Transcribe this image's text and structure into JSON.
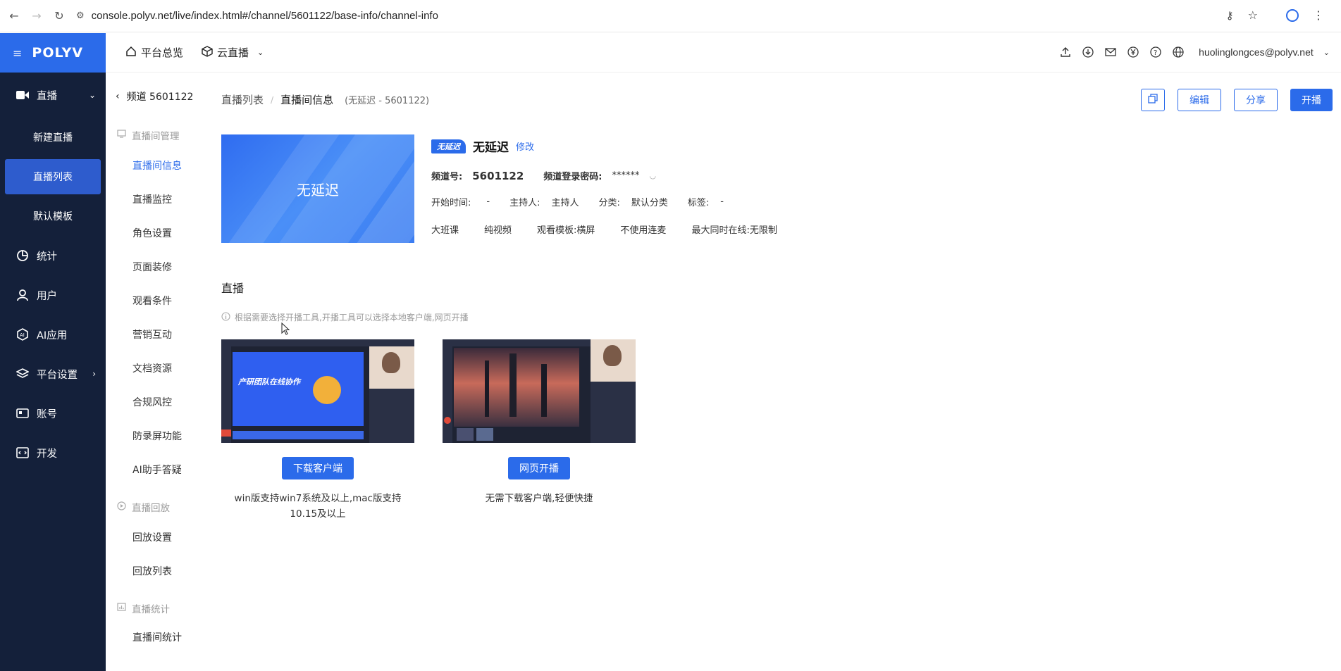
{
  "browser": {
    "url": "console.polyv.net/live/index.html#/channel/5601122/base-info/channel-info"
  },
  "sidebar": {
    "logo": "POLYV",
    "items": [
      {
        "label": "直播",
        "icon": "video-camera-icon"
      },
      {
        "label": "新建直播"
      },
      {
        "label": "直播列表"
      },
      {
        "label": "默认模板"
      },
      {
        "label": "统计",
        "icon": "pie-chart-icon"
      },
      {
        "label": "用户",
        "icon": "user-icon"
      },
      {
        "label": "AI应用",
        "icon": "ai-icon"
      },
      {
        "label": "平台设置",
        "icon": "layers-icon"
      },
      {
        "label": "账号",
        "icon": "id-card-icon"
      },
      {
        "label": "开发",
        "icon": "code-icon"
      }
    ]
  },
  "topbar": {
    "overview": "平台总览",
    "cloud_live": "云直播",
    "email": "huolinglongces@polyv.net"
  },
  "subnav": {
    "back": "频道 5601122",
    "group1": "直播间管理",
    "group1_items": [
      "直播间信息",
      "直播监控",
      "角色设置",
      "页面装修",
      "观看条件",
      "营销互动",
      "文档资源",
      "合规风控",
      "防录屏功能",
      "AI助手答疑"
    ],
    "group2": "直播回放",
    "group2_items": [
      "回放设置",
      "回放列表"
    ],
    "group3": "直播统计",
    "group3_items": [
      "直播间统计"
    ]
  },
  "main": {
    "crumb_list": "直播列表",
    "crumb_sep": "/",
    "crumb_current": "直播间信息",
    "crumb_sub": "(无延迟 - 5601122)",
    "btn_edit": "编辑",
    "btn_share": "分享",
    "btn_start": "开播",
    "cover_text": "无延迟",
    "badge": "无延迟",
    "title": "无延迟",
    "modify": "修改",
    "channel_no_label": "频道号:",
    "channel_no": "5601122",
    "pwd_label": "频道登录密码:",
    "pwd": "******",
    "start_label": "开始时间:",
    "start_val": "-",
    "host_label": "主持人:",
    "host_val": "主持人",
    "cat_label": "分类:",
    "cat_val": "默认分类",
    "tag_label": "标签:",
    "tag_val": "-",
    "tags_row": [
      "大班课",
      "纯视频",
      "观看模板:横屏",
      "不使用连麦",
      "最大同时在线:无限制"
    ],
    "section": "直播",
    "tip": "根据需要选择开播工具,开播工具可以选择本地客户端,网页开播",
    "tool1_btn": "下载客户端",
    "tool1_desc": "win版支持win7系统及以上,mac版支持10.15及以上",
    "tool2_btn": "网页开播",
    "tool2_desc": "无需下载客户端,轻便快捷",
    "shot1_banner": "产研团队在线协作"
  }
}
